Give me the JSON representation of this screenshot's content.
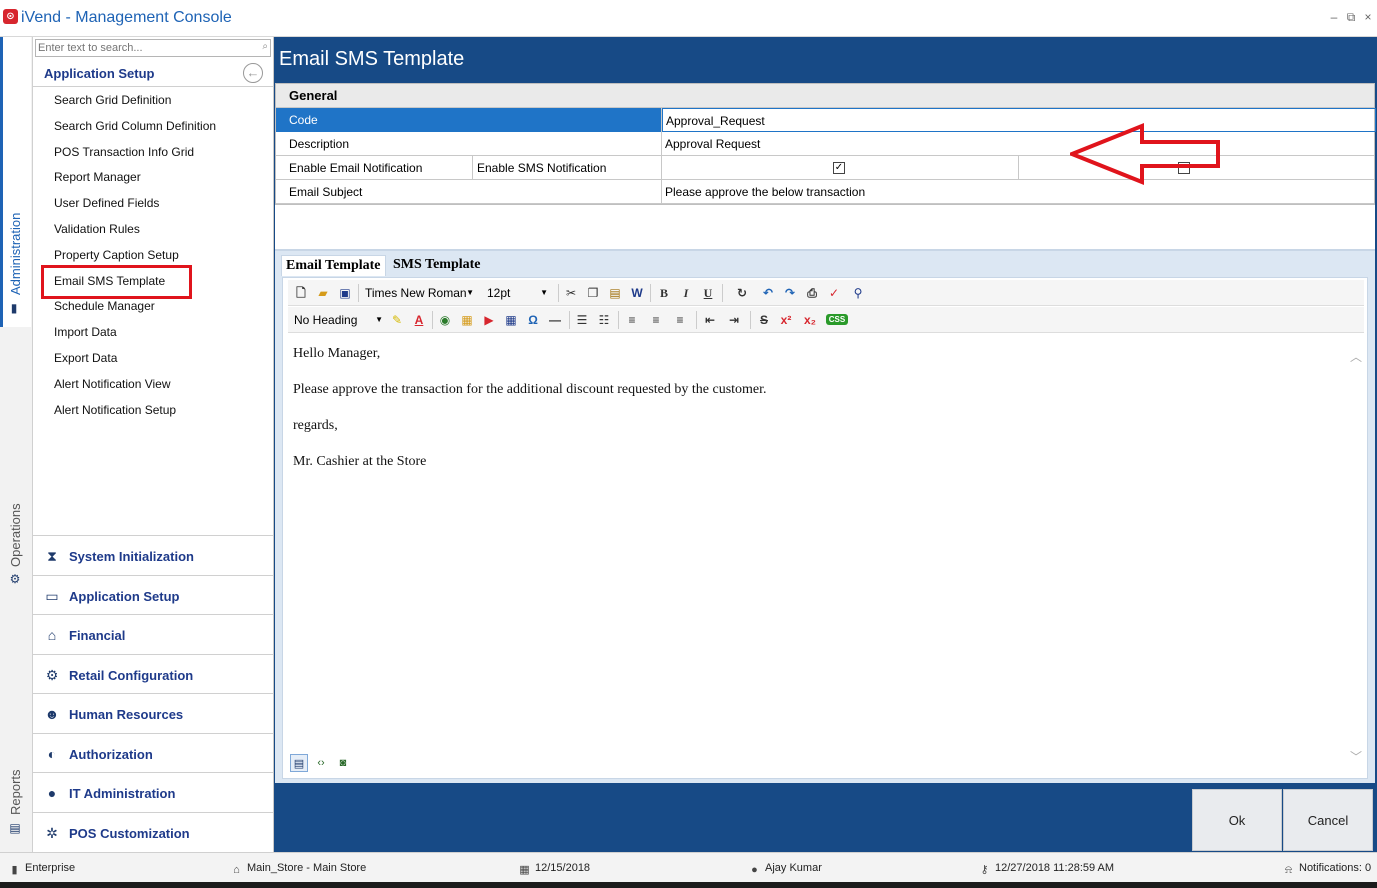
{
  "window": {
    "title": "iVend - Management Console",
    "minimize": "–",
    "restore": "⧉",
    "close": "×"
  },
  "vertical_tabs": [
    {
      "label": "Administration"
    },
    {
      "label": "Operations"
    },
    {
      "label": "Reports"
    }
  ],
  "sidebar": {
    "search_placeholder": "Enter text to search...",
    "section_title": "Application Setup",
    "items": [
      {
        "label": "Search Grid Definition"
      },
      {
        "label": "Search Grid Column Definition"
      },
      {
        "label": "POS Transaction Info Grid"
      },
      {
        "label": "Report Manager"
      },
      {
        "label": "User Defined Fields"
      },
      {
        "label": "Validation Rules"
      },
      {
        "label": "Property Caption Setup"
      },
      {
        "label": "Email SMS Template"
      },
      {
        "label": "Schedule Manager"
      },
      {
        "label": "Import Data"
      },
      {
        "label": "Export Data"
      },
      {
        "label": "Alert Notification View"
      },
      {
        "label": "Alert Notification Setup"
      }
    ],
    "groups": [
      {
        "label": "System Initialization",
        "icon": "hourglass-icon"
      },
      {
        "label": "Application Setup",
        "icon": "window-icon"
      },
      {
        "label": "Financial",
        "icon": "bank-icon"
      },
      {
        "label": "Retail Configuration",
        "icon": "gears-icon"
      },
      {
        "label": "Human Resources",
        "icon": "users-search-icon"
      },
      {
        "label": "Authorization",
        "icon": "shield-icon"
      },
      {
        "label": "IT Administration",
        "icon": "user-icon"
      },
      {
        "label": "POS Customization",
        "icon": "pos-gear-icon"
      }
    ]
  },
  "main": {
    "title": "Email SMS Template",
    "form": {
      "section": "General",
      "code_label": "Code",
      "code_value": "Approval_Request",
      "description_label": "Description",
      "description_value": "Approval Request",
      "enable_email_label": "Enable Email Notification",
      "enable_sms_label": "Enable SMS Notification",
      "enable_email_checked": true,
      "enable_sms_checked": false,
      "subject_label": "Email Subject",
      "subject_value": "Please approve the below transaction"
    },
    "tabs": [
      {
        "label": "Email Template"
      },
      {
        "label": "SMS Template"
      }
    ],
    "toolbar": {
      "font_name": "Times New Roman",
      "font_size": "12pt",
      "heading": "No Heading",
      "bold": "B",
      "italic": "I",
      "underline": "U"
    },
    "content": {
      "line1": "Hello Manager,",
      "line2": "Please approve the transaction for the additional discount requested by the customer.",
      "line3": "regards,",
      "line4": "Mr. Cashier at the Store"
    },
    "ok_label": "Ok",
    "cancel_label": "Cancel"
  },
  "status": {
    "edition": "Enterprise",
    "store": "Main_Store - Main Store",
    "date": "12/15/2018",
    "user": "Ajay Kumar",
    "login_time": "12/27/2018 11:28:59 AM",
    "notifications": "Notifications: 0"
  },
  "colors": {
    "accent": "#1e63b5",
    "header_blue": "#174a86",
    "selected_row": "#1f74c7",
    "highlight_red": "#e0141c"
  }
}
